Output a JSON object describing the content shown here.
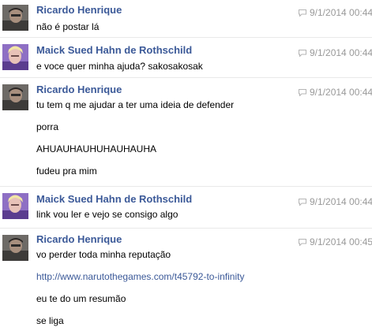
{
  "colors": {
    "author": "#3b5998",
    "link": "#3b5998",
    "timestamp": "#999999",
    "divider": "#e9e9e9"
  },
  "messages": [
    {
      "author": "Ricardo Henrique",
      "avatar": "ricardo",
      "timestamp": "9/1/2014 00:44",
      "lines": [
        "não é postar lá"
      ]
    },
    {
      "author": "Maick Sued Hahn de Rothschild",
      "avatar": "maick",
      "timestamp": "9/1/2014 00:44",
      "lines": [
        "e voce quer minha ajuda? sakosakosak"
      ]
    },
    {
      "author": "Ricardo Henrique",
      "avatar": "ricardo",
      "timestamp": "9/1/2014 00:44",
      "lines": [
        "tu tem q me ajudar a ter uma ideia de defender",
        "porra",
        "AHUAUHAUHUHAUHAUHA",
        "fudeu pra mim"
      ]
    },
    {
      "author": "Maick Sued Hahn de Rothschild",
      "avatar": "maick",
      "timestamp": "9/1/2014 00:44",
      "lines": [
        "link vou ler e vejo se consigo algo"
      ]
    },
    {
      "author": "Ricardo Henrique",
      "avatar": "ricardo",
      "timestamp": "9/1/2014 00:45",
      "lines": [
        "vo perder toda minha reputação",
        "http://www.narutothegames.com/t45792-to-infinity",
        "eu te do um resumão",
        "se liga"
      ]
    }
  ]
}
